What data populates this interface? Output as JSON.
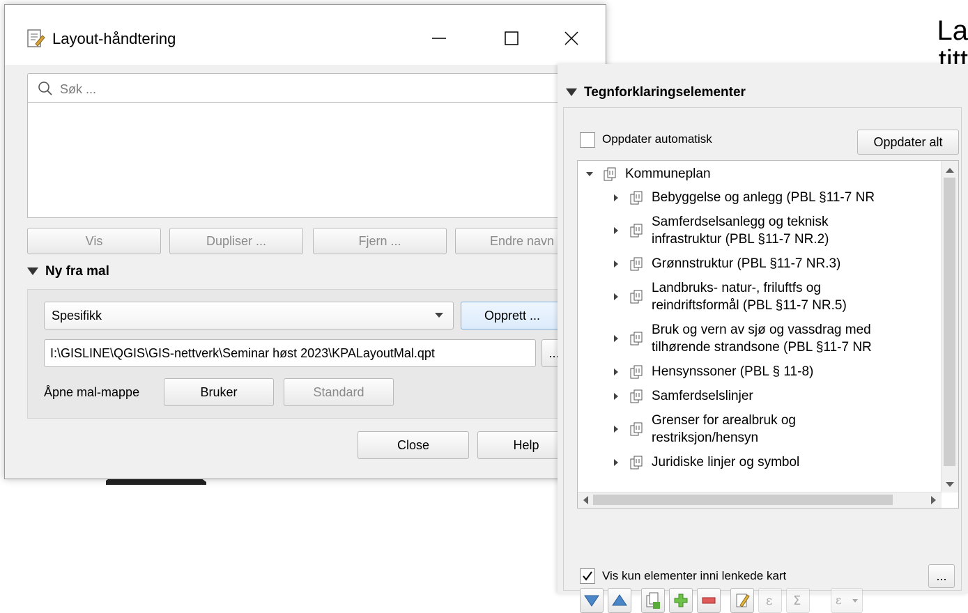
{
  "background": {
    "heading_fragment_1": "La",
    "heading_fragment_2": "titt"
  },
  "layout_dialog": {
    "title": "Layout-håndtering",
    "search_placeholder": "Søk ...",
    "buttons": {
      "show": "Vis",
      "duplicate": "Dupliser ...",
      "remove": "Fjern ...",
      "rename": "Endre navn"
    },
    "new_from_template": {
      "section_title": "Ny fra mal",
      "template_type": "Spesifikk",
      "create_label": "Opprett ...",
      "template_path": "I:\\GISLINE\\QGIS\\GIS-nettverk\\Seminar høst 2023\\KPALayoutMal.qpt",
      "browse_label": "...",
      "open_folder_label": "Åpne mal-mappe",
      "user_label": "Bruker",
      "default_label": "Standard"
    },
    "close_label": "Close",
    "help_label": "Help"
  },
  "legend_panel": {
    "section_title": "Tegnforklaringselementer",
    "auto_update_label": "Oppdater automatisk",
    "update_all_label": "Oppdater alt",
    "tree": {
      "root": "Kommuneplan",
      "groups": [
        {
          "lines": [
            "Bebyggelse og anlegg (PBL §11-7 NR"
          ]
        },
        {
          "lines": [
            "Samferdselsanlegg og teknisk",
            "infrastruktur (PBL §11-7 NR.2)"
          ]
        },
        {
          "lines": [
            "Grønnstruktur (PBL §11-7 NR.3)"
          ]
        },
        {
          "lines": [
            "Landbruks- natur-, friluftfs og",
            "reindriftsformål (PBL §11-7 NR.5)"
          ]
        },
        {
          "lines": [
            "Bruk og vern av sjø og vassdrag med",
            "tilhørende strandsone (PBL §11-7 NR"
          ]
        },
        {
          "lines": [
            "Hensynssoner (PBL § 11-8)"
          ]
        },
        {
          "lines": [
            "Samferdselslinjer"
          ]
        },
        {
          "lines": [
            "Grenser for arealbruk og",
            "restriksjon/hensyn"
          ]
        },
        {
          "lines": [
            "Juridiske linjer og symbol"
          ]
        }
      ]
    },
    "filter_label": "Vis kun elementer inni lenkede kart",
    "filter_checked": true,
    "more_label": "...",
    "toolbar_icons": [
      "move-down-icon",
      "move-up-icon",
      "add-group-icon",
      "add-item-icon",
      "remove-item-icon",
      "edit-icon",
      "expression-icon",
      "sum-icon",
      "filter-expression-icon"
    ]
  }
}
